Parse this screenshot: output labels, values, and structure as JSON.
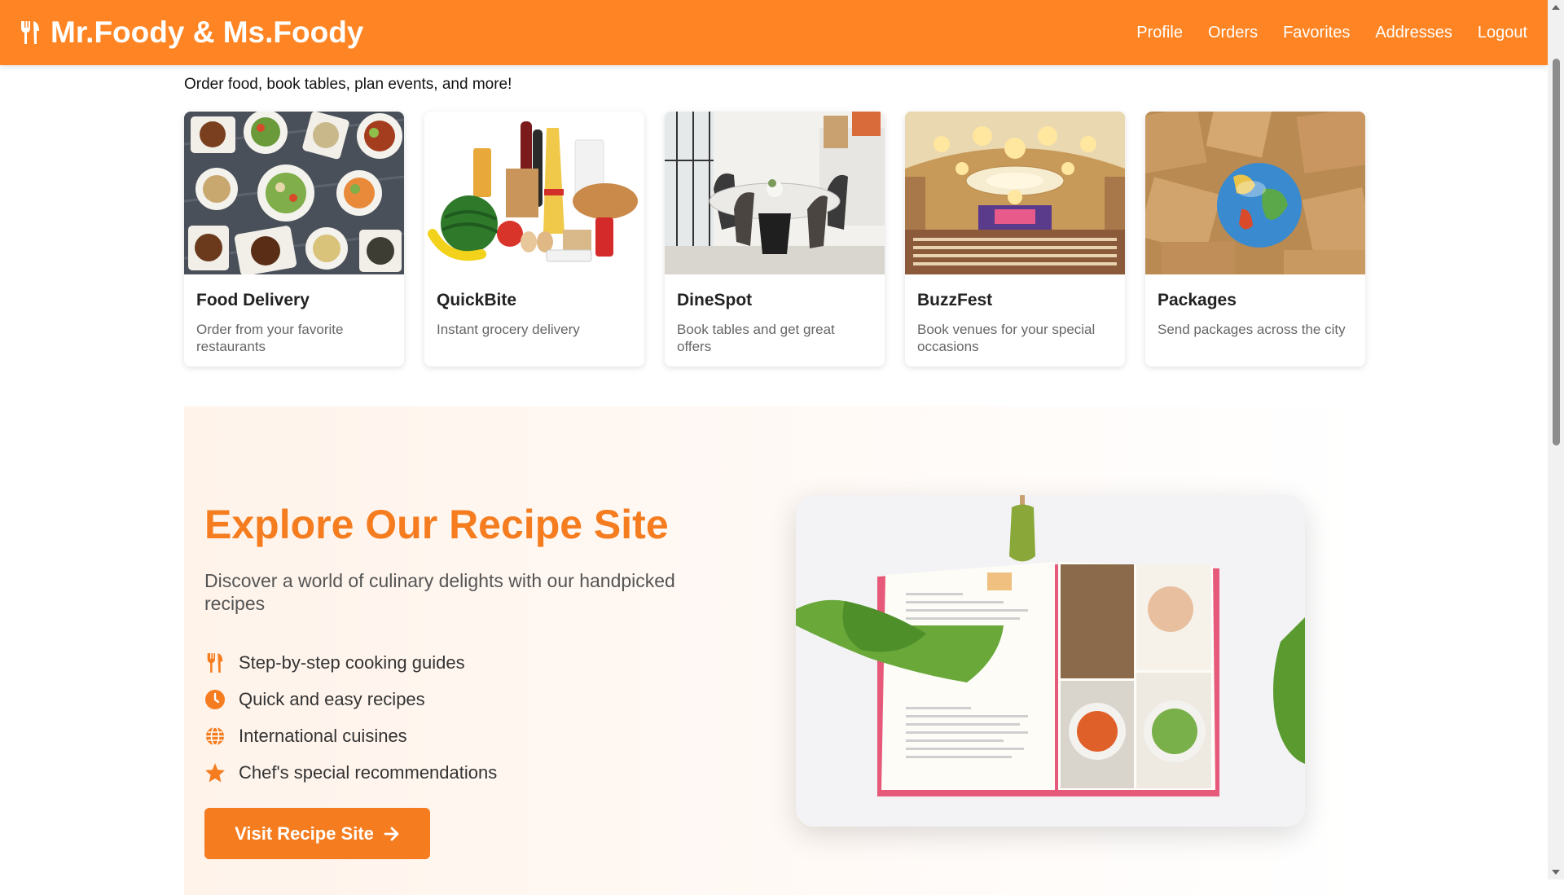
{
  "header": {
    "brand": "Mr.Foody & Ms.Foody",
    "brand_icon": "utensils-icon",
    "nav": [
      "Profile",
      "Orders",
      "Favorites",
      "Addresses",
      "Logout"
    ]
  },
  "tagline": "Order food, book tables, plan events, and more!",
  "services": [
    {
      "title": "Food Delivery",
      "description": "Order from your favorite restaurants",
      "image": "food-dishes-image"
    },
    {
      "title": "QuickBite",
      "description": "Instant grocery delivery",
      "image": "groceries-image"
    },
    {
      "title": "DineSpot",
      "description": "Book tables and get great offers",
      "image": "dining-table-image"
    },
    {
      "title": "BuzzFest",
      "description": "Book venues for your special occasions",
      "image": "banquet-hall-image"
    },
    {
      "title": "Packages",
      "description": "Send packages across the city",
      "image": "packages-globe-image"
    }
  ],
  "recipe": {
    "title": "Explore Our Recipe Site",
    "subtitle": "Discover a world of culinary delights with our handpicked recipes",
    "features": [
      {
        "icon": "utensils-icon",
        "label": "Step-by-step cooking guides"
      },
      {
        "icon": "clock-icon",
        "label": "Quick and easy recipes"
      },
      {
        "icon": "globe-icon",
        "label": "International cuisines"
      },
      {
        "icon": "star-icon",
        "label": "Chef's special recommendations"
      }
    ],
    "button_label": "Visit Recipe Site",
    "button_icon": "arrow-right-icon",
    "image": "recipe-book-image"
  },
  "colors": {
    "primary": "#ff8524",
    "accent": "#f57c1f",
    "section_bg": "#fff3ea"
  }
}
